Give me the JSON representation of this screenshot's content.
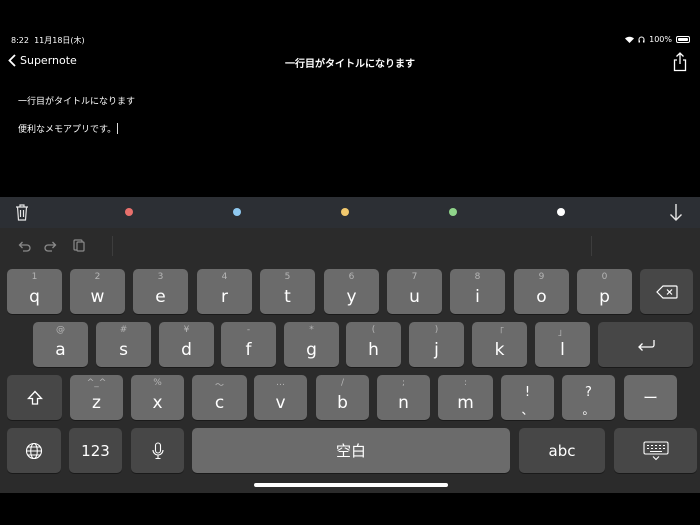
{
  "status": {
    "time": "8:22",
    "date": "11月18日(木)",
    "battery": "100%"
  },
  "nav": {
    "back_label": "Supernote",
    "title": "一行目がタイトルになります"
  },
  "note": {
    "line1": "一行目がタイトルになります",
    "line2": "便利なメモアプリです。"
  },
  "colors": {
    "red": "#e8706c",
    "blue": "#8fc9f0",
    "yellow": "#f1c86d",
    "green": "#8fd48a",
    "white": "#ffffff"
  },
  "keyboard": {
    "row1": [
      {
        "sub": "1",
        "main": "q"
      },
      {
        "sub": "2",
        "main": "w"
      },
      {
        "sub": "3",
        "main": "e"
      },
      {
        "sub": "4",
        "main": "r"
      },
      {
        "sub": "5",
        "main": "t"
      },
      {
        "sub": "6",
        "main": "y"
      },
      {
        "sub": "7",
        "main": "u"
      },
      {
        "sub": "8",
        "main": "i"
      },
      {
        "sub": "9",
        "main": "o"
      },
      {
        "sub": "0",
        "main": "p"
      }
    ],
    "row2": [
      {
        "sub": "@",
        "main": "a"
      },
      {
        "sub": "#",
        "main": "s"
      },
      {
        "sub": "¥",
        "main": "d"
      },
      {
        "sub": "-",
        "main": "f"
      },
      {
        "sub": "*",
        "main": "g"
      },
      {
        "sub": "(",
        "main": "h"
      },
      {
        "sub": ")",
        "main": "j"
      },
      {
        "sub": "「",
        "main": "k"
      },
      {
        "sub": "」",
        "main": "l"
      }
    ],
    "row3": [
      {
        "sub": "^_^",
        "main": "z"
      },
      {
        "sub": "%",
        "main": "x"
      },
      {
        "sub": "〜",
        "main": "c"
      },
      {
        "sub": "…",
        "main": "v"
      },
      {
        "sub": "/",
        "main": "b"
      },
      {
        "sub": ";",
        "main": "n"
      },
      {
        "sub": ":",
        "main": "m"
      },
      {
        "sub": "!",
        "main": "、"
      },
      {
        "sub": "?",
        "main": "。"
      }
    ],
    "dash": "ー",
    "numbers": "123",
    "space": "空白",
    "abc": "abc"
  }
}
